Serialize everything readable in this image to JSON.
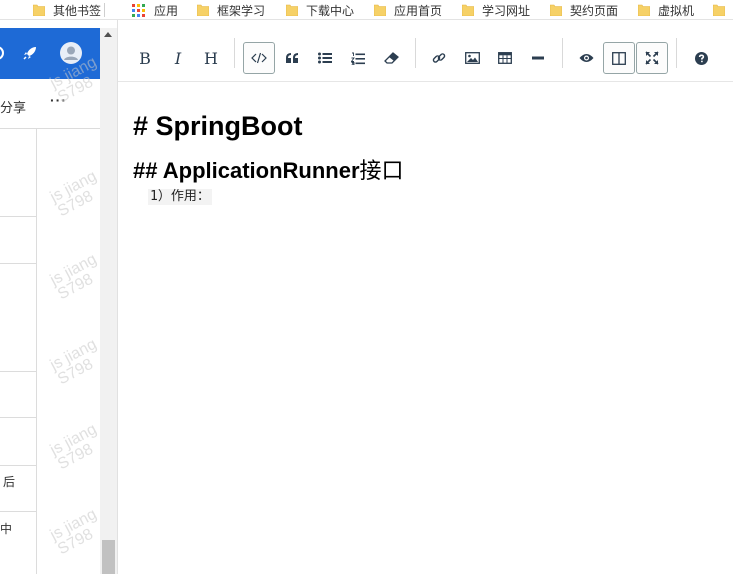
{
  "bookmarks": [
    {
      "label": "其他书签",
      "icon": "folder-icon"
    },
    {
      "label": "应用",
      "icon": "apps-grid-icon"
    },
    {
      "label": "框架学习",
      "icon": "folder-icon"
    },
    {
      "label": "下载中心",
      "icon": "folder-icon"
    },
    {
      "label": "应用首页",
      "icon": "folder-icon"
    },
    {
      "label": "学习网址",
      "icon": "folder-icon"
    },
    {
      "label": "契约页面",
      "icon": "folder-icon"
    },
    {
      "label": "虚拟机",
      "icon": "folder-icon"
    }
  ],
  "left_pane": {
    "share_label": "分享",
    "more_label": "···",
    "row_texts": [
      "后",
      "中"
    ],
    "watermark_lines": [
      "js jiang",
      "S798"
    ],
    "colors": {
      "header_bg": "#1e6ad6"
    }
  },
  "toolbar": {
    "bold_label": "B",
    "italic_label": "I",
    "heading_label": "H",
    "buttons": [
      "bold",
      "italic",
      "heading",
      "code",
      "quote",
      "unordered-list",
      "ordered-list",
      "eraser",
      "link",
      "image",
      "table",
      "horizontal-rule",
      "preview",
      "side-by-side",
      "fullscreen",
      "help"
    ],
    "active": [
      "code",
      "side-by-side",
      "fullscreen"
    ]
  },
  "editor": {
    "h1": "# SpringBoot",
    "h2_prefix": "## ApplicationRunner",
    "h2_suffix": "接口",
    "line1": "1）作用："
  }
}
